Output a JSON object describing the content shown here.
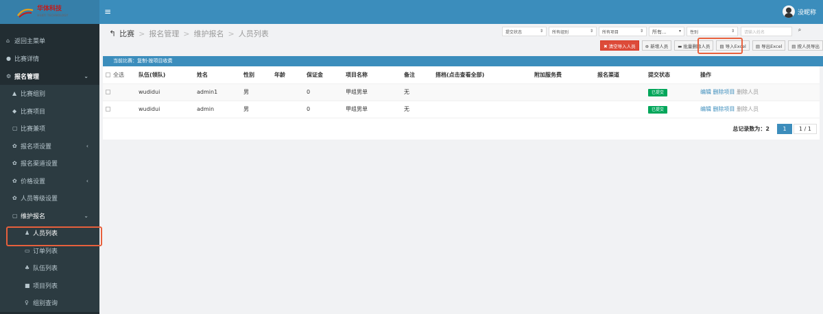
{
  "header": {
    "logo_text": "华体科技",
    "logo_sub": "HUATI TECHNOLOGY",
    "user_name": "没昵称"
  },
  "sidebar": {
    "items": [
      {
        "label": "返回主菜单",
        "icon": "home-icon"
      },
      {
        "label": "比赛详情",
        "icon": "info-icon"
      },
      {
        "label": "报名管理",
        "icon": "cogs-icon"
      },
      {
        "label": "比赛组别",
        "icon": "user-icon"
      },
      {
        "label": "比赛项目",
        "icon": "gamepad-icon"
      },
      {
        "label": "比赛兼项",
        "icon": "copy-icon"
      },
      {
        "label": "报名项设置",
        "icon": "gear-icon"
      },
      {
        "label": "报名渠道设置",
        "icon": "gear-icon"
      },
      {
        "label": "价格设置",
        "icon": "gear-icon"
      },
      {
        "label": "人员等级设置",
        "icon": "gear-icon"
      },
      {
        "label": "维护报名",
        "icon": "copy-icon"
      },
      {
        "label": "人员列表",
        "icon": "person-icon"
      },
      {
        "label": "订单列表",
        "icon": "card-icon"
      },
      {
        "label": "队伍列表",
        "icon": "group-icon"
      },
      {
        "label": "项目列表",
        "icon": "square-icon"
      },
      {
        "label": "组别查询",
        "icon": "female-icon"
      }
    ]
  },
  "breadcrumb": {
    "items": [
      "比赛",
      "报名管理",
      "维护报名",
      "人员列表"
    ]
  },
  "filters": {
    "status": "提交状态",
    "group": "所有组别",
    "project": "所有项目",
    "all": "所有...",
    "gender": "性别",
    "name_placeholder": "请输入姓名"
  },
  "toolbar": {
    "clear_import": "清空导入人员",
    "add": "新增人员",
    "batch_delete": "批量删除人员",
    "import_excel": "导入Excel",
    "export_excel": "导出Excel",
    "export_by_person": "按人员导出"
  },
  "current_match": "当前比赛：复制-按项目收费",
  "table": {
    "columns": [
      "全选",
      "队伍(领队)",
      "姓名",
      "性别",
      "年龄",
      "保证金",
      "项目名称",
      "备注",
      "搭档(点击查看全部)",
      "附加服务费",
      "报名渠道",
      "提交状态",
      "操作"
    ],
    "rows": [
      {
        "team": "wudidui",
        "name": "admin1",
        "gender": "男",
        "age": "",
        "deposit": "0",
        "project": "甲组男单",
        "note": "无",
        "partner": "",
        "extra": "",
        "channel": "",
        "status": "已提交"
      },
      {
        "team": "wudidui",
        "name": "admin",
        "gender": "男",
        "age": "",
        "deposit": "0",
        "project": "甲组男单",
        "note": "无",
        "partner": "",
        "extra": "",
        "channel": "",
        "status": "已提交"
      }
    ],
    "actions": {
      "edit": "编辑",
      "delete_project": "删除项目",
      "delete_person": "删除人员"
    }
  },
  "pager": {
    "total": "总记录数为：2",
    "current": "1",
    "info": "1 / 1"
  },
  "colors": {
    "header": "#3b8dbc",
    "sidebar": "#222d32",
    "highlight": "#e8603c",
    "success": "#00a65a"
  }
}
